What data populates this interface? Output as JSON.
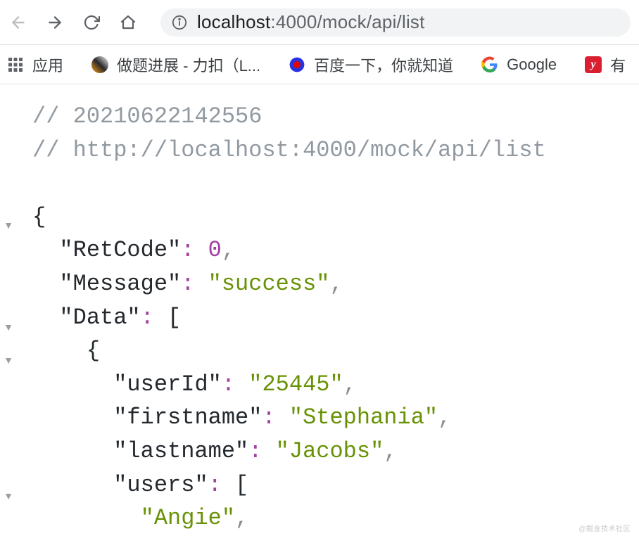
{
  "toolbar": {
    "url_host": "localhost",
    "url_path": ":4000/mock/api/list"
  },
  "bookmarks": {
    "apps": "应用",
    "leetcode": "做题进展 - 力扣（L...",
    "baidu": "百度一下，你就知道",
    "google": "Google",
    "partial": "有"
  },
  "json": {
    "comment_ts": "// 20210622142556",
    "comment_url": "// http://localhost:4000/mock/api/list",
    "retcode_key": "\"RetCode\"",
    "retcode_val": "0",
    "message_key": "\"Message\"",
    "message_val": "\"success\"",
    "data_key": "\"Data\"",
    "userid_key": "\"userId\"",
    "userid_val": "\"25445\"",
    "firstname_key": "\"firstname\"",
    "firstname_val": "\"Stephania\"",
    "lastname_key": "\"lastname\"",
    "lastname_val": "\"Jacobs\"",
    "users_key": "\"users\"",
    "users_0": "\"Angie\""
  },
  "watermark": "@掘金技术社区"
}
